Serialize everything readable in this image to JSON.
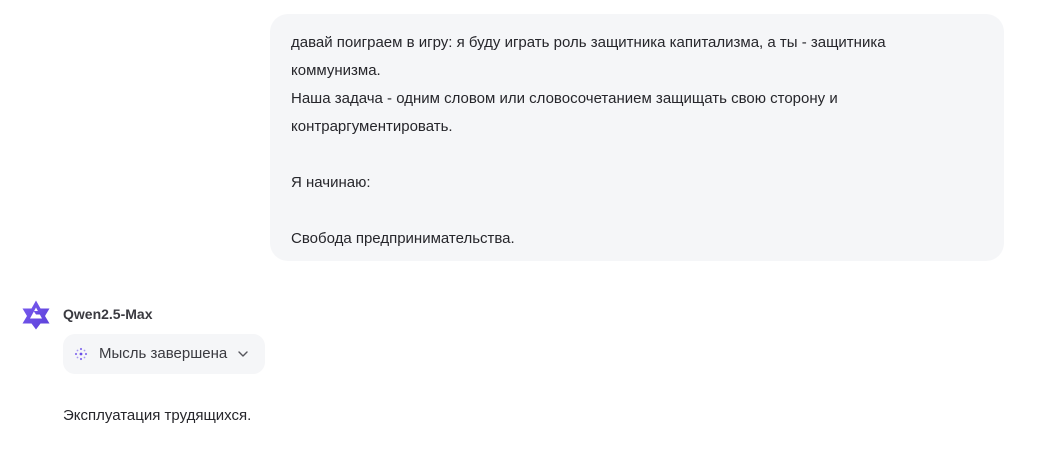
{
  "user_message": {
    "lines": [
      "давай поиграем в игру: я буду играть роль защитника капитализма, а ты - защитника",
      "коммунизма.",
      "Наша задача - одним словом или словосочетанием защищать свою сторону и",
      "контраргументировать.",
      "",
      "Я начинаю:",
      "",
      "Свобода предпринимательства."
    ]
  },
  "assistant": {
    "name": "Qwen2.5-Max",
    "avatar_icon": "qwen-logo-icon",
    "brand_color": "#6b4ee8",
    "thought_status": {
      "icon": "sparkle-dots-icon",
      "label": "Мысль завершена",
      "expand_icon": "chevron-down-icon"
    },
    "reply": "Эксплуатация трудящихся."
  }
}
